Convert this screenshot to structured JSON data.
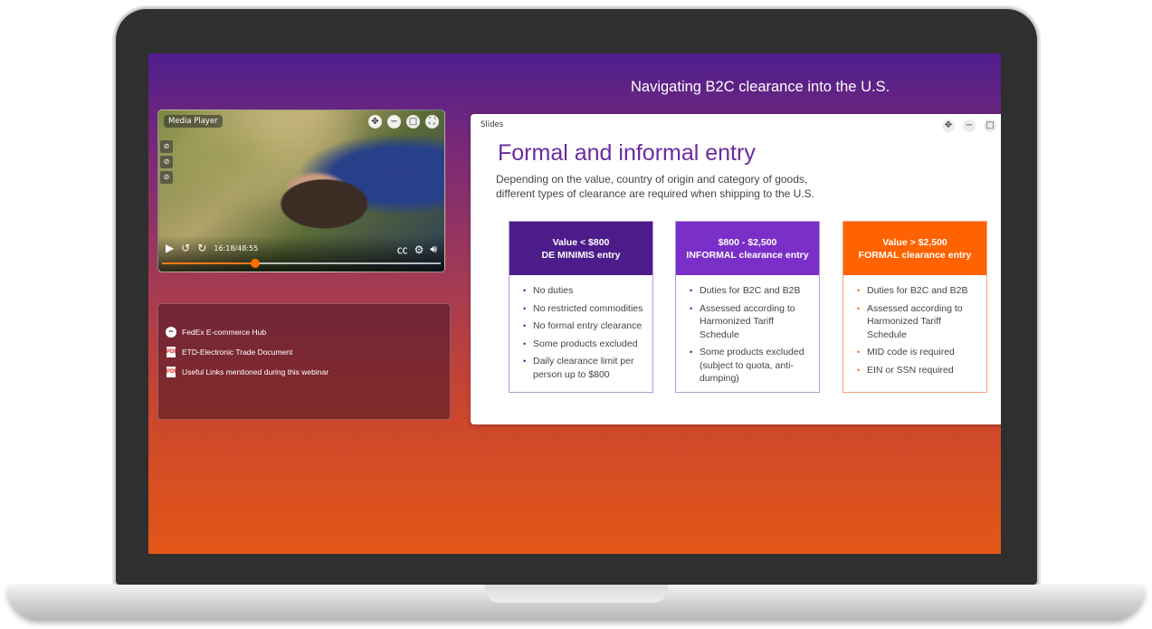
{
  "stage": {
    "title": "Navigating B2C clearance into the U.S."
  },
  "media_player": {
    "label": "Media Player",
    "current_time": "16:18",
    "duration": "48:55",
    "time_display": "16:18/48:55",
    "progress_fraction": 0.333,
    "icons": {
      "move": "move-icon",
      "minimize": "minimize-icon",
      "maximize": "maximize-icon",
      "fullscreen": "fullscreen-icon",
      "play": "play-icon",
      "rewind": "rewind-icon",
      "forward": "forward-icon",
      "captions": "captions-icon",
      "settings": "settings-icon",
      "volume": "volume-icon"
    }
  },
  "resources": {
    "items": [
      {
        "label": "FedEx E-commerce Hub",
        "icon": "link-icon"
      },
      {
        "label": "ETD-Electronic Trade Document",
        "icon": "pdf-icon"
      },
      {
        "label": "Useful Links mentioned during this webinar",
        "icon": "pdf-icon"
      }
    ]
  },
  "slides": {
    "label": "Slides",
    "heading": "Formal and informal entry",
    "subtitle": "Depending on the value, country of origin and category of goods, different types of clearance are required  when shipping to the U.S.",
    "columns": [
      {
        "head_line1": "Value < $800",
        "head_line2": "DE MINIMIS entry",
        "color": "#4b1c8a",
        "items": [
          "No duties",
          "No restricted commodities",
          "No formal entry clearance",
          "Some products excluded",
          "Daily clearance limit per person up to $800"
        ]
      },
      {
        "head_line1": "$800 - $2,500",
        "head_line2": "INFORMAL clearance entry",
        "color": "#7a2fc8",
        "items": [
          "Duties for B2C and B2B",
          "Assessed according to Harmonized Tariff Schedule",
          "Some products excluded (subject to quota, anti-dumping)"
        ]
      },
      {
        "head_line1": "Value > $2,500",
        "head_line2": "FORMAL clearance entry",
        "color": "#ff6200",
        "items": [
          "Duties for B2C and B2B",
          "Assessed according to Harmonized Tariff Schedule",
          "MID code is  required",
          "EIN or SSN required"
        ]
      }
    ]
  }
}
